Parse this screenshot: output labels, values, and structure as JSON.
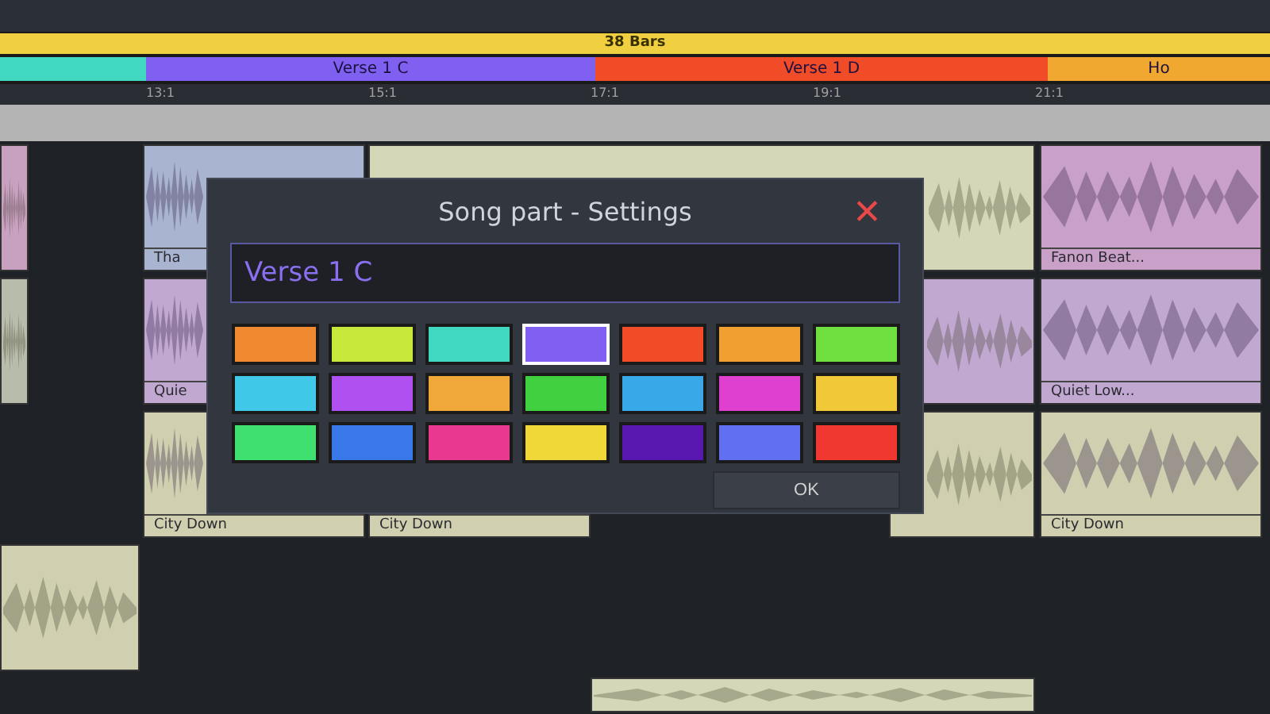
{
  "arranger": {
    "length_label": "38 Bars",
    "song_parts": [
      {
        "color": "#40d8c0"
      },
      {
        "label": "Verse 1 C",
        "color": "#8060f0"
      },
      {
        "label": "Verse 1 D",
        "color": "#f04c28"
      },
      {
        "label": "Ho",
        "color": "#f0a830"
      }
    ],
    "ruler": [
      "13:1",
      "15:1",
      "17:1",
      "19:1",
      "21:1"
    ],
    "clips": [
      {
        "label": "Tha",
        "color": "#a8b4d0"
      },
      {
        "label": "Fanon Beat...",
        "color": "#c8a0c8"
      },
      {
        "label": "Quie",
        "color": "#c0a8d0"
      },
      {
        "label": "Quiet Low...",
        "color": "#c0a8d0"
      },
      {
        "label": "City Down",
        "color": "#d0d0b0"
      },
      {
        "label": "City Down",
        "color": "#d0d0b0"
      },
      {
        "label": "City Down",
        "color": "#d0d0b0"
      }
    ]
  },
  "dialog": {
    "title": "Song part - Settings",
    "close": "✕",
    "name_value": "Verse 1 C",
    "swatches": [
      {
        "color": "#f08a30",
        "selected": false
      },
      {
        "color": "#c8e83c",
        "selected": false
      },
      {
        "color": "#40d8c0",
        "selected": false
      },
      {
        "color": "#8060f0",
        "selected": true
      },
      {
        "color": "#f04c28",
        "selected": false
      },
      {
        "color": "#f0a030",
        "selected": false
      },
      {
        "color": "#70e040",
        "selected": false
      },
      {
        "color": "#40c8e8",
        "selected": false
      },
      {
        "color": "#b050f0",
        "selected": false
      },
      {
        "color": "#f0a838",
        "selected": false
      },
      {
        "color": "#40d040",
        "selected": false
      },
      {
        "color": "#38a8e8",
        "selected": false
      },
      {
        "color": "#e040d0",
        "selected": false
      },
      {
        "color": "#f0c838",
        "selected": false
      },
      {
        "color": "#40e070",
        "selected": false
      },
      {
        "color": "#3878e8",
        "selected": false
      },
      {
        "color": "#e83890",
        "selected": false
      },
      {
        "color": "#f0d838",
        "selected": false
      },
      {
        "color": "#5818b0",
        "selected": false
      },
      {
        "color": "#6070f0",
        "selected": false
      },
      {
        "color": "#f03830",
        "selected": false
      }
    ],
    "ok": "OK"
  }
}
